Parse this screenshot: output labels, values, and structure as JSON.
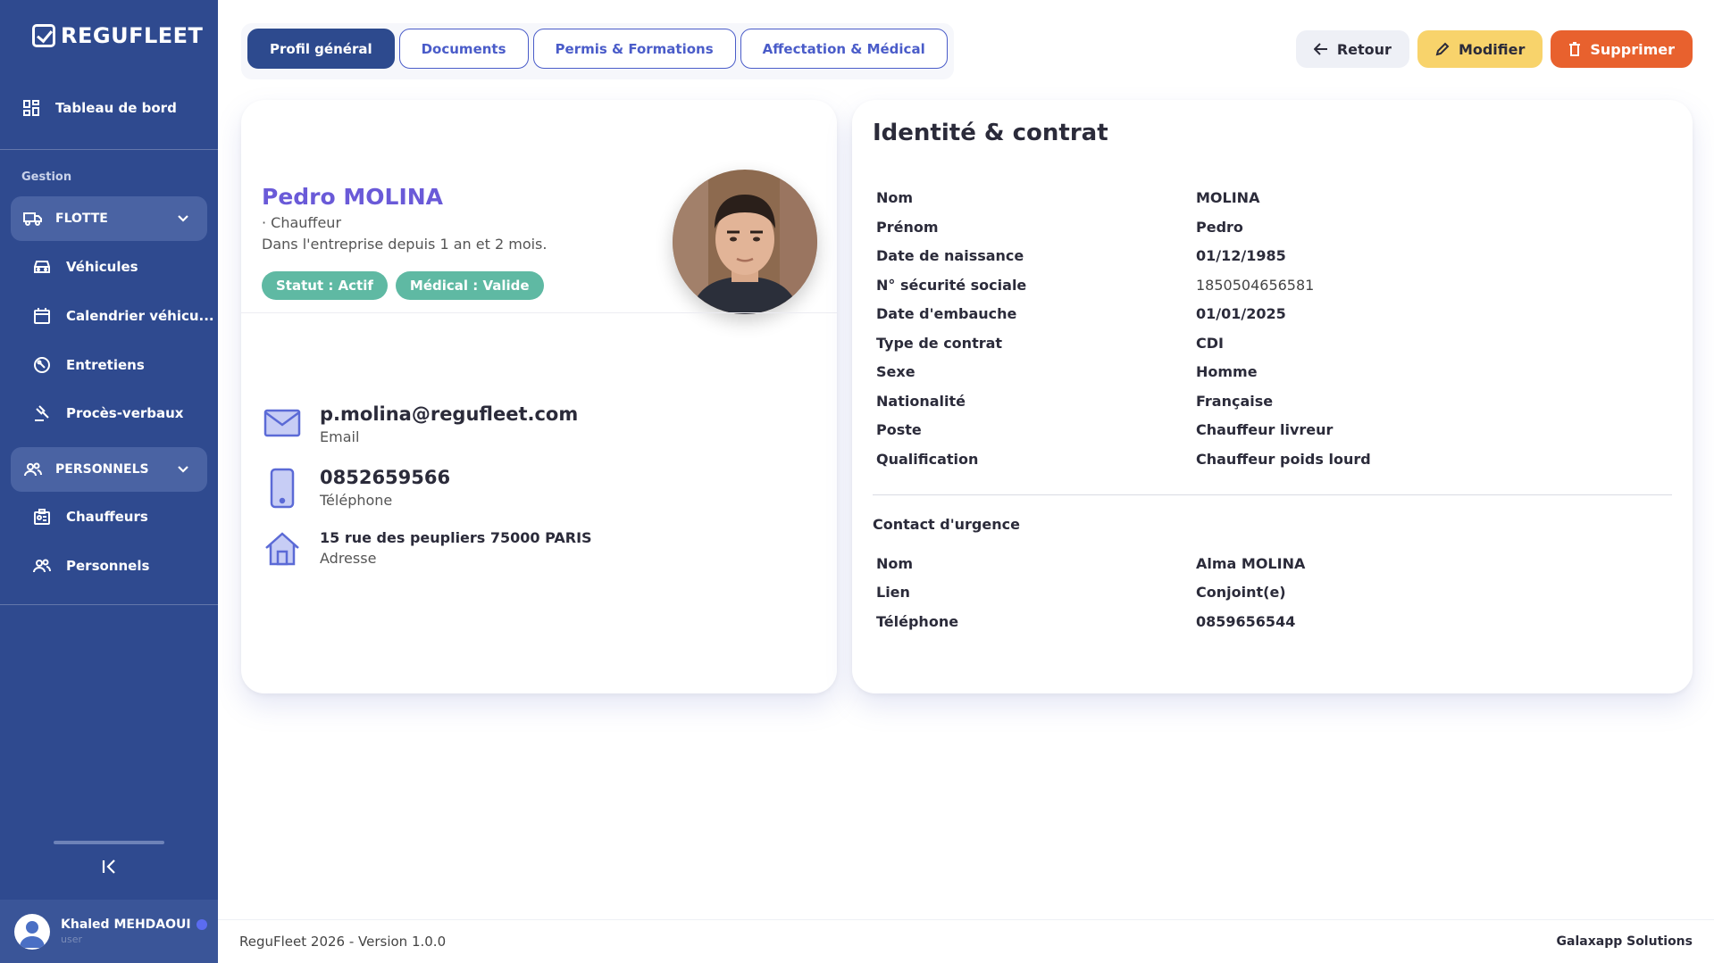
{
  "app": {
    "logo_text": "REGUFLEET"
  },
  "sidebar": {
    "dashboard_label": "Tableau de bord",
    "section_label": "Gestion",
    "groups": [
      {
        "label": "FLOTTE",
        "items": [
          "Véhicules",
          "Calendrier véhicu...",
          "Entretiens",
          "Procès-verbaux"
        ]
      },
      {
        "label": "PERSONNELS",
        "items": [
          "Chauffeurs",
          "Personnels"
        ]
      }
    ],
    "user": {
      "name": "Khaled MEHDAOUI",
      "role": "user"
    }
  },
  "tabs": [
    "Profil général",
    "Documents",
    "Permis & Formations",
    "Affectation & Médical"
  ],
  "actions": {
    "back": "Retour",
    "edit": "Modifier",
    "delete": "Supprimer"
  },
  "profile": {
    "name": "Pedro MOLINA",
    "role": "· Chauffeur",
    "since": "Dans l'entreprise depuis 1 an et 2 mois.",
    "badges": [
      "Statut : Actif",
      "Médical : Valide"
    ],
    "contacts": [
      {
        "value": "p.molina@regufleet.com",
        "label": "Email",
        "icon": "mail-icon"
      },
      {
        "value": "0852659566",
        "label": "Téléphone",
        "icon": "phone-icon"
      },
      {
        "value": "15 rue des peupliers 75000 PARIS",
        "label": "Adresse",
        "icon": "home-icon"
      }
    ]
  },
  "identity": {
    "title": "Identité & contrat",
    "rows": [
      {
        "key": "Nom",
        "value": "MOLINA"
      },
      {
        "key": "Prénom",
        "value": "Pedro"
      },
      {
        "key": "Date de naissance",
        "value": "01/12/1985"
      },
      {
        "key": "N° sécurité sociale",
        "value": "1850504656581"
      },
      {
        "key": "Date d'embauche",
        "value": "01/01/2025"
      },
      {
        "key": "Type de contrat",
        "value": "CDI"
      },
      {
        "key": "Sexe",
        "value": "Homme"
      },
      {
        "key": "Nationalité",
        "value": "Française"
      },
      {
        "key": "Poste",
        "value": "Chauffeur livreur"
      },
      {
        "key": "Qualification",
        "value": "Chauffeur poids lourd"
      }
    ],
    "emergency_title": "Contact d'urgence",
    "emergency": [
      {
        "key": "Nom",
        "value": "Alma MOLINA"
      },
      {
        "key": "Lien",
        "value": "Conjoint(e)"
      },
      {
        "key": "Téléphone",
        "value": "0859656544"
      }
    ]
  },
  "footer": {
    "left": "ReguFleet 2026 - Version 1.0.0",
    "right": "Galaxapp Solutions"
  }
}
